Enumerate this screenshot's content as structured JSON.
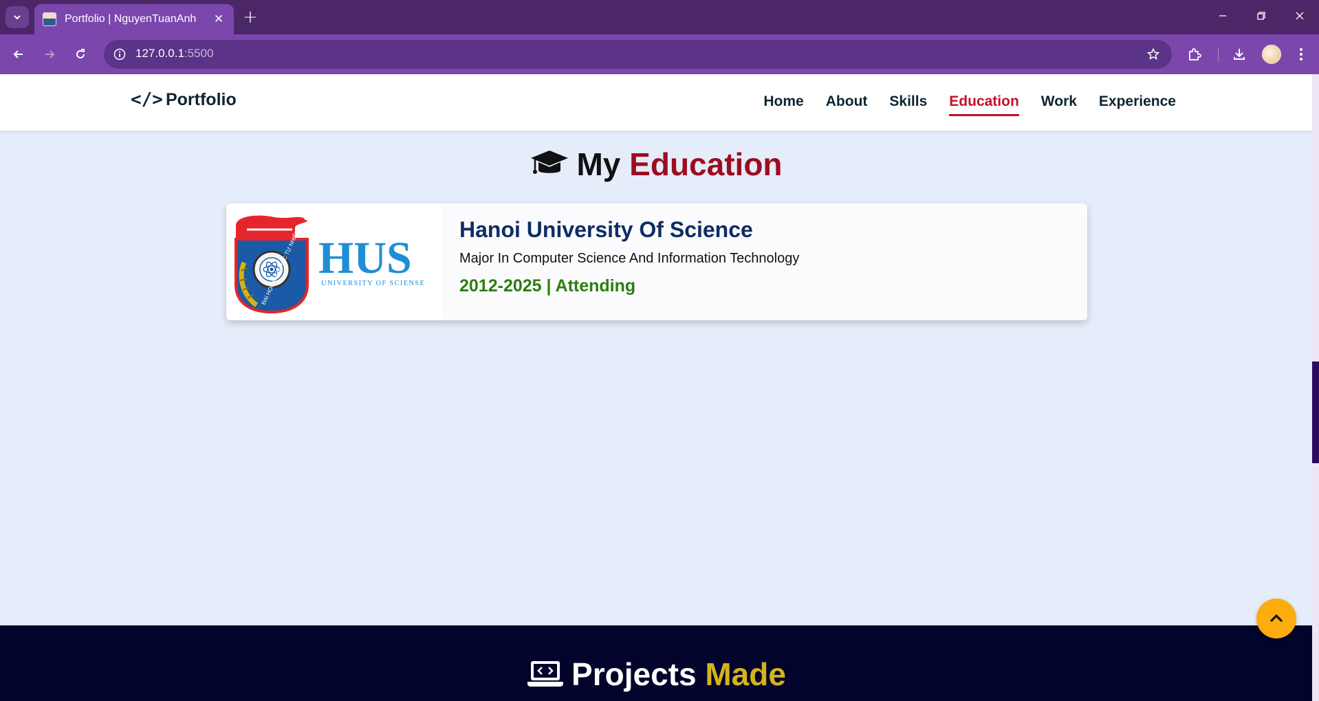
{
  "browser": {
    "tab_title": "Portfolio | NguyenTuanAnh",
    "url_host": "127.0.0.1",
    "url_port": ":5500"
  },
  "site": {
    "logo_text": "Portfolio",
    "logo_symbol": "</>",
    "nav": [
      {
        "label": "Home"
      },
      {
        "label": "About"
      },
      {
        "label": "Skills"
      },
      {
        "label": "Education",
        "active": true
      },
      {
        "label": "Work"
      },
      {
        "label": "Experience"
      }
    ]
  },
  "education": {
    "title_plain": "My",
    "title_accent": "Education",
    "title_icon": "graduation-cap-icon",
    "cards": [
      {
        "logo_text": "HUS",
        "logo_subtext": "UNIVERSITY OF SCIENSE",
        "logo_ring_text": "ĐẠI HỌC KHOA HỌC TỰ NHIÊN",
        "school": "Hanoi University Of Science",
        "major": "Major In Computer Science And Information Technology",
        "years": "2012-2025 | Attending"
      }
    ]
  },
  "projects": {
    "title_plain": "Projects",
    "title_accent": "Made",
    "title_icon": "laptop-code-icon"
  },
  "colors": {
    "accent_red": "#9c0d1f",
    "nav_active": "#c4102a",
    "school_blue": "#0f2c64",
    "years_green": "#2c7d12",
    "projects_accent": "#d4b41b",
    "scroll_top_bg": "#fcac0d",
    "browser_frame": "#7b47ad"
  }
}
